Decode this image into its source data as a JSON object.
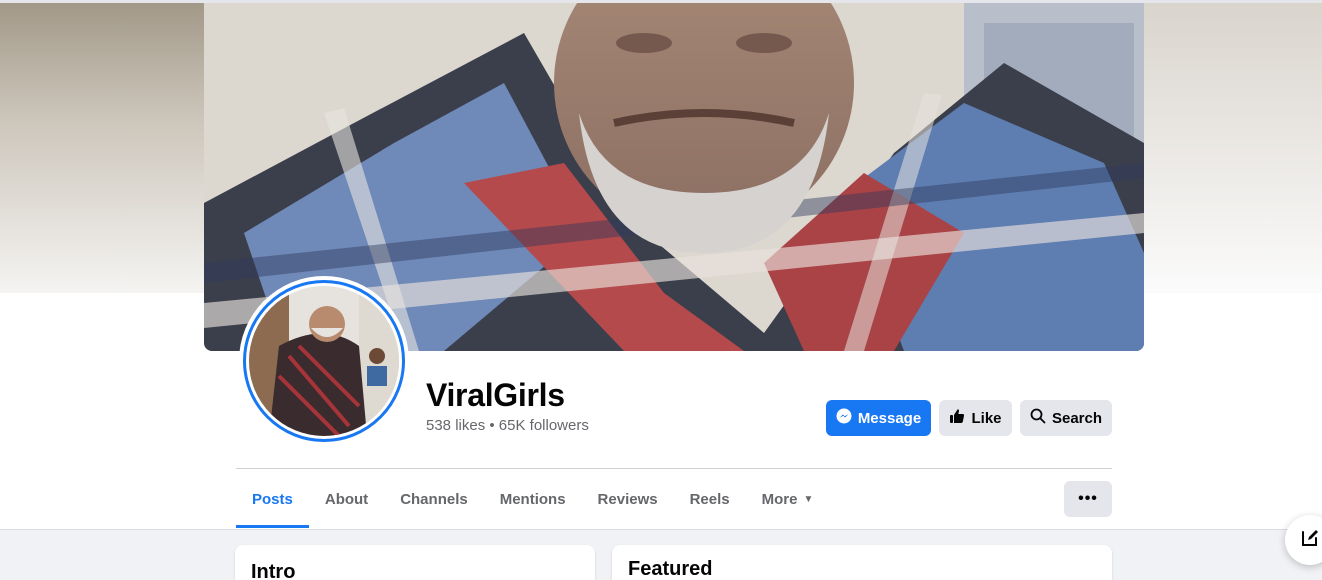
{
  "page": {
    "name": "ViralGirls",
    "stats": "538 likes • 65K followers"
  },
  "actions": {
    "message_label": "Message",
    "like_label": "Like",
    "search_label": "Search",
    "more_options_label": "•••"
  },
  "tabs": [
    {
      "label": "Posts",
      "active": true
    },
    {
      "label": "About",
      "active": false
    },
    {
      "label": "Channels",
      "active": false
    },
    {
      "label": "Mentions",
      "active": false
    },
    {
      "label": "Reviews",
      "active": false
    },
    {
      "label": "Reels",
      "active": false
    },
    {
      "label": "More",
      "active": false,
      "dropdown": true
    }
  ],
  "cards": {
    "intro_title": "Intro",
    "featured_title": "Featured"
  },
  "icons": {
    "message": "messenger-icon",
    "like": "thumbs-up-icon",
    "search": "search-icon",
    "more_caret": "caret-down-icon",
    "compose": "compose-icon"
  },
  "colors": {
    "accent": "#1877f2",
    "button_gray": "#e4e6eb",
    "text_secondary": "#65676b",
    "content_bg": "#f0f2f5"
  }
}
